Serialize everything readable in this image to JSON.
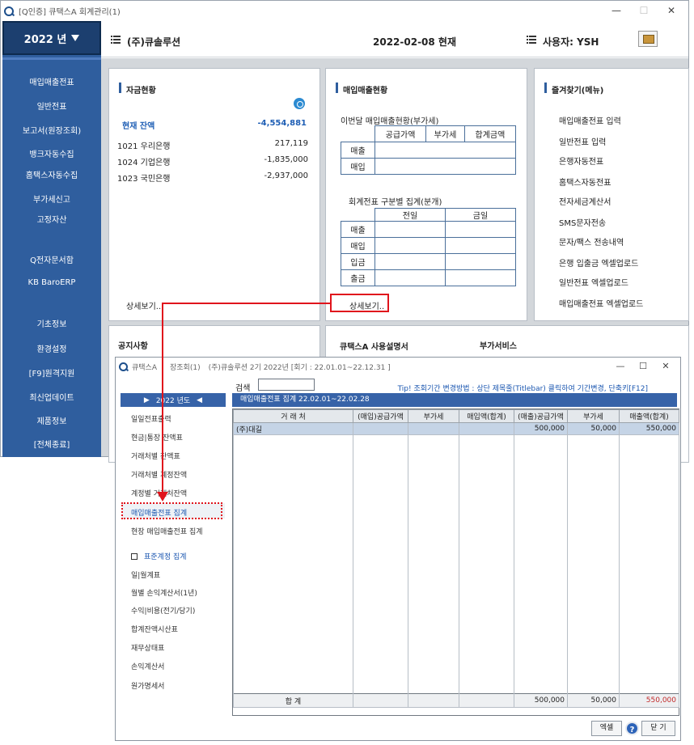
{
  "main": {
    "title": "[Q인증] 큐택스A 회계관리(1)",
    "controls": {
      "minimize": "—",
      "maximize": "☐",
      "close": "✕"
    }
  },
  "sidebar": {
    "year": "2022 년",
    "items": [
      "매입매출전표",
      "일반전표",
      "보고서(원장조회)",
      "뱅크자동수집",
      "홈택스자동수집",
      "부가세신고",
      "고정자산",
      "Q전자문서함",
      "KB BaroERP",
      "기초정보",
      "환경설정",
      "[F9]원격지원",
      "최신업데이트",
      "제품정보",
      "[전체종료]"
    ]
  },
  "header": {
    "company": "(주)큐솔루션",
    "date": "2022-02-08 현재",
    "user": "사용자: YSH"
  },
  "fund": {
    "title": "자금현황",
    "balance_label": "현재 잔액",
    "balance_value": "-4,554,881",
    "banks": [
      {
        "name": "1021  우리은행",
        "value": "217,119"
      },
      {
        "name": "1024  기업은행",
        "value": "-1,835,000"
      },
      {
        "name": "1023  국민은행",
        "value": "-2,937,000"
      }
    ],
    "detail": "상세보기.."
  },
  "sales": {
    "title": "매입매출현황",
    "vat_title": "이번달 매입매출현황(부가세)",
    "vat_headers": [
      "공급가액",
      "부가세",
      "합계금액"
    ],
    "vat_rows": [
      "매출",
      "매입"
    ],
    "cat_title": "회계전표 구분별 집계(분개)",
    "cat_headers": [
      "전일",
      "금일"
    ],
    "cat_rows": [
      "매출",
      "매입",
      "입금",
      "출금"
    ],
    "detail": "상세보기.."
  },
  "favorites": {
    "title": "즐겨찾기(메뉴)",
    "items": [
      "매입매출전표 입력",
      "일반전표 입력",
      "은행자동전표",
      "홈택스자동전표",
      "전자세금계산서",
      "SMS문자전송",
      "문자/팩스 전송내역",
      "은행 입출금 엑셀업로드",
      "일반전표 엑셀업로드",
      "매입매출전표 엑셀업로드"
    ]
  },
  "bottom_panels": {
    "notice": "공지사항",
    "manual": "큐택스A 사용설명서",
    "addon": "부가서비스"
  },
  "popup": {
    "title_left": "큐택스A",
    "title_mid": "장조회(1)",
    "title_right": "(주)큐솔루션 2기 2022년 [회기 : 22.01.01~22.12.31 ]",
    "controls": {
      "minimize": "—",
      "maximize": "☐",
      "close": "✕"
    },
    "search_label": "검색",
    "search_value": "",
    "tip": "Tip! 조회기간 변경방법 : 상단 제목줄(Titlebar) 클릭하여 기간변경, 단축키[F12]",
    "year_bar": "2022 년도",
    "report_bar": "매입매출전표 집계  22.02.01~22.02.28",
    "left_menu": [
      "일일전표출력",
      "현금|통장 잔액표",
      "거래처별 잔액표",
      "거래처별 계정잔액",
      "계정별 거래처잔액",
      "매입매출전표 집계",
      "현장 매입매출전표 집계"
    ],
    "checkbox_label": "표준계정 집계",
    "left_menu2": [
      "일|월계표",
      "월별 손익계산서(1년)",
      "수익|비용(전기/당기)",
      "합계잔액시산표",
      "재무상태표",
      "손익계산서",
      "원가명세서"
    ],
    "grid_headers": [
      "거 래 처",
      "(매입)공급가액",
      "부가세",
      "매입액(합계)",
      "(매출)공급가액",
      "부가세",
      "매출액(합계)"
    ],
    "rows": [
      [
        "(주)대길",
        "",
        "",
        "",
        "500,000",
        "50,000",
        "550,000"
      ]
    ],
    "total": [
      "합    계",
      "",
      "",
      "",
      "500,000",
      "50,000",
      "550,000"
    ],
    "buttons": {
      "excel": "엑셀",
      "help": "?",
      "close": "닫 기"
    }
  }
}
